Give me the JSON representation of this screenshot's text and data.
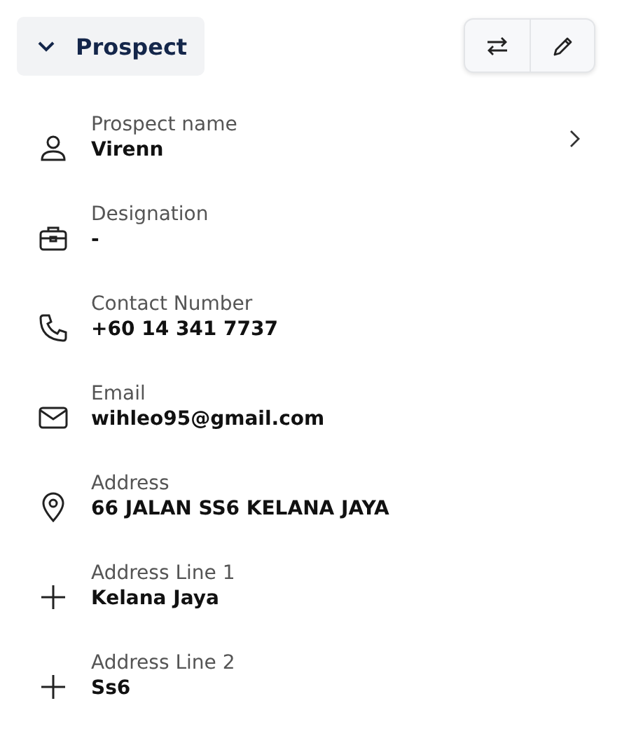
{
  "section": {
    "title": "Prospect",
    "expanded": true
  },
  "fields": [
    {
      "kind": "person",
      "label": "Prospect name",
      "value": "Virenn",
      "chevron": true
    },
    {
      "kind": "briefcase",
      "label": "Designation",
      "value": "-",
      "chevron": false
    },
    {
      "kind": "phone",
      "label": "Contact Number",
      "value": "+60 14 341 7737",
      "chevron": false
    },
    {
      "kind": "mail",
      "label": "Email",
      "value": "wihleo95@gmail.com",
      "chevron": false
    },
    {
      "kind": "pin",
      "label": "Address",
      "value": "66 JALAN SS6 KELANA JAYA",
      "chevron": false
    },
    {
      "kind": "plus",
      "label": "Address Line 1",
      "value": "Kelana Jaya",
      "chevron": false
    },
    {
      "kind": "plus",
      "label": "Address Line 2",
      "value": "Ss6",
      "chevron": false
    }
  ]
}
